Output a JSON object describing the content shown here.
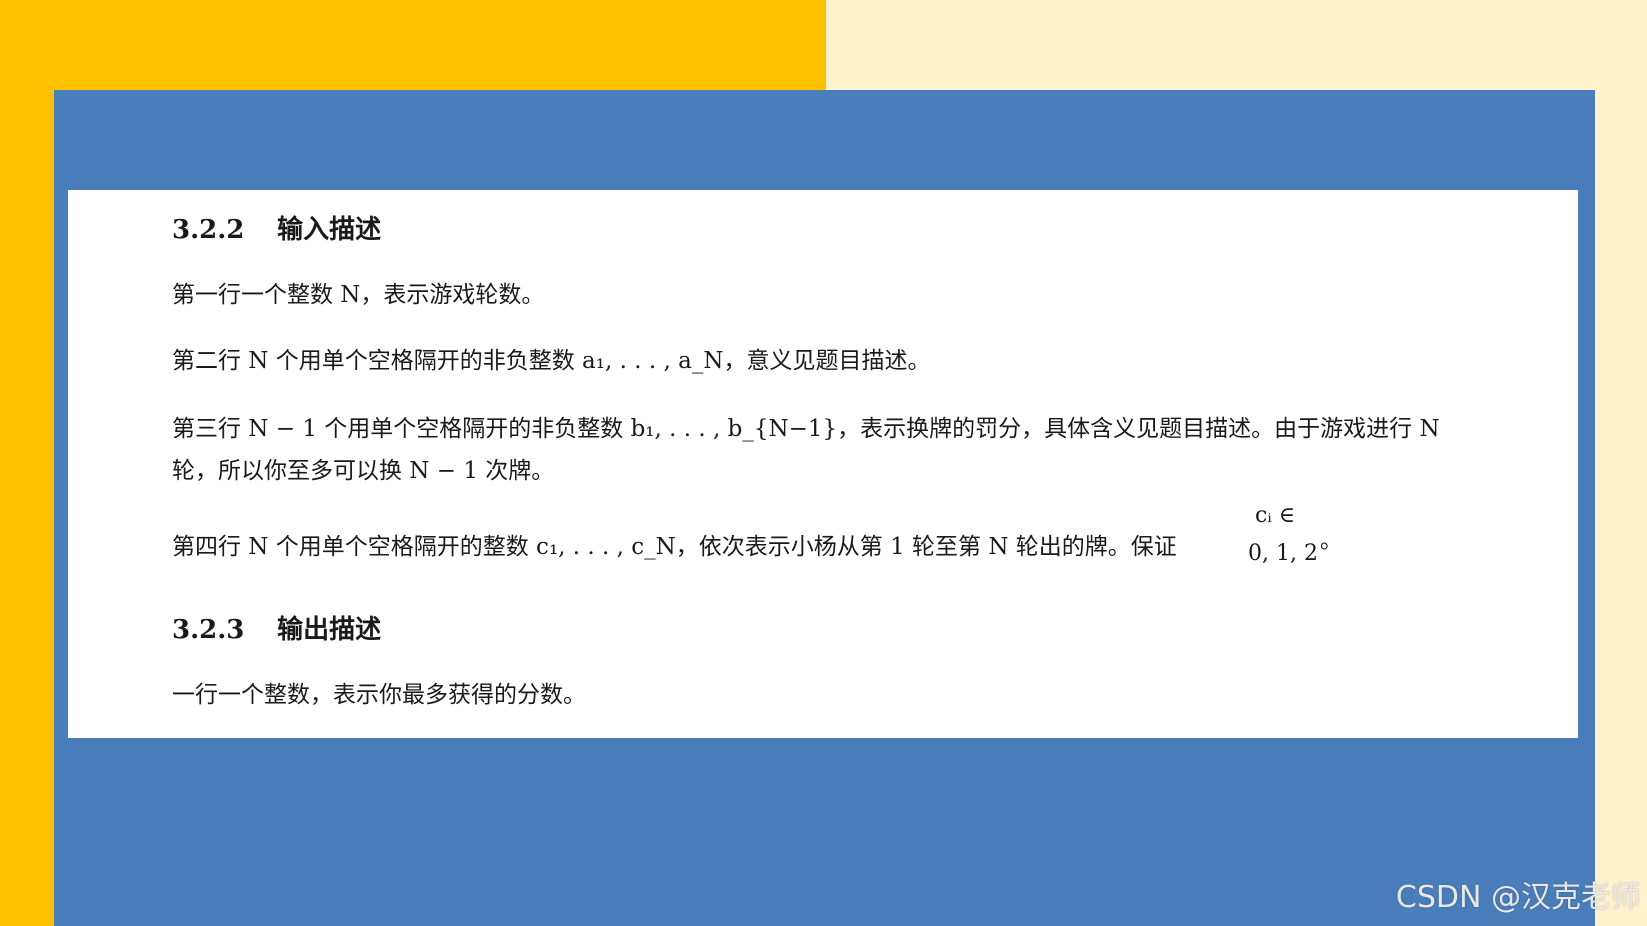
{
  "colors": {
    "left_background": "#ffc000",
    "right_background": "#fff2cc",
    "frame": "#4a7ebb",
    "card": "#ffffff",
    "text": "#1a1a1a"
  },
  "section_input": {
    "number": "3.2.2",
    "title": "输入描述",
    "line1": "第一行一个整数 N，表示游戏轮数。",
    "line2": "第二行 N 个用单个空格隔开的非负整数 a₁, . . . , a_N，意义见题目描述。",
    "line3a": "第三行 N − 1 个用单个空格隔开的非负整数 b₁, . . . , b_{N−1}，表示换牌的罚分，具体含义见题目描述。由于游戏进行 N",
    "line3b": "轮，所以你至多可以换 N − 1 次牌。",
    "line4": "第四行 N 个用单个空格隔开的整数 c₁, . . . , c_N，依次表示小杨从第 1 轮至第 N 轮出的牌。保证",
    "guarantee_top": "cᵢ ∈",
    "guarantee_bottom": "0, 1, 2",
    "guarantee_end": "。"
  },
  "section_output": {
    "number": "3.2.3",
    "title": "输出描述",
    "line1": "一行一个整数，表示你最多获得的分数。"
  },
  "watermark": "CSDN @汉克老师"
}
